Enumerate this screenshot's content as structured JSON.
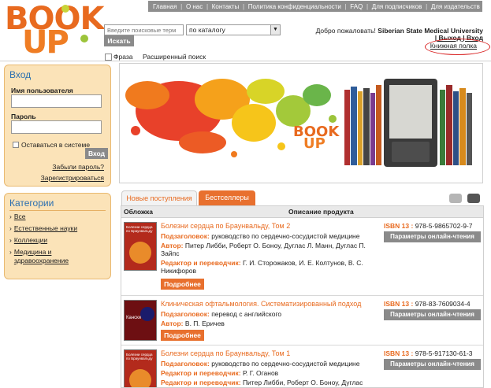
{
  "logo": {
    "line1": "BOOK",
    "line2": "UP"
  },
  "topnav": [
    "Главная",
    "О нас",
    "Контакты",
    "Политика конфиденциальности",
    "FAQ",
    "Для подписчиков",
    "Для издательств"
  ],
  "search": {
    "placeholder": "Введите поисковые терм",
    "scope": "по каталогу",
    "button": "Искать",
    "phrase": "Фраза",
    "advanced": "Расширенный поиск"
  },
  "user": {
    "welcome": "Добро пожаловать!",
    "org": "Siberian State Medical University",
    "cabinet": "| Выход | Вход",
    "shelf": "Книжная полка"
  },
  "login": {
    "title": "Вход",
    "username": "Имя пользователя",
    "password": "Пароль",
    "remember": "Оставаться в системе",
    "button": "Вход",
    "forgot": "Забыли пароль?",
    "register": "Зарегистрироваться"
  },
  "categories": {
    "title": "Категории",
    "items": [
      "Все",
      "Естественные науки",
      "Коллекции",
      "Медицина и здравоохранение"
    ]
  },
  "tabs": {
    "new": "Новые поступления",
    "best": "Бестселлеры"
  },
  "table": {
    "col_cover": "Обложка",
    "col_desc": "Описание продукта"
  },
  "labels": {
    "subtitle": "Подзаголовок:",
    "author": "Автор:",
    "editor": "Редактор и переводчик:",
    "isbn": "ISBN 13 :",
    "more": "Подробнее",
    "read": "Параметры онлайн-чтения"
  },
  "products": [
    {
      "title": "Болезни сердца по Браунвальду, Том 2",
      "subtitle": "руководство по сердечно-сосудистой медицине",
      "author": "Питер Либби, Роберт О. Боноу, Дуглас Л. Манн, Дуглас П. Зайпс",
      "editor": "Г. И. Сторожаков, И. Е. Колтунов, В. С. Никифоров",
      "isbn": "978-5-9865702-9-7",
      "cover_text": "Болезни сердца по Браунвальду"
    },
    {
      "title": "Клиническая офтальмология. Систематизированный подход",
      "subtitle": "перевод с английского",
      "author": "В. П. Еричев",
      "isbn": "978-83-7609034-4",
      "cover_text": "Кански"
    },
    {
      "title": "Болезни сердца по Браунвальду, Том 1",
      "subtitle": "руководство по сердечно-сосудистой медицине",
      "editor1": "Р. Г. Оганов",
      "editor2": "Питер Либби, Роберт О. Боноу, Дуглас",
      "isbn": "978-5-917130-61-3",
      "cover_text": "Болезни сердца по Браунвальду"
    }
  ]
}
